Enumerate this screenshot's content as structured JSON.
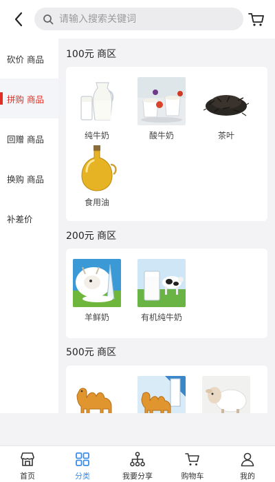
{
  "header": {
    "search_placeholder": "请输入搜索关键词"
  },
  "sidebar": {
    "items": [
      {
        "label": "砍价 商品",
        "active": false
      },
      {
        "label": "拼购 商品",
        "active": true
      },
      {
        "label": "回赠 商品",
        "active": false
      },
      {
        "label": "换购 商品",
        "active": false
      },
      {
        "label": "补差价",
        "active": false
      }
    ]
  },
  "sections": [
    {
      "title": "100元 商区",
      "products": [
        {
          "name": "纯牛奶",
          "icon": "milk-jug-icon"
        },
        {
          "name": "酸牛奶",
          "icon": "yogurt-icon"
        },
        {
          "name": "茶叶",
          "icon": "tea-leaves-icon"
        },
        {
          "name": "食用油",
          "icon": "oil-bottle-icon"
        }
      ]
    },
    {
      "title": "200元 商区",
      "products": [
        {
          "name": "羊鲜奶",
          "icon": "goat-milk-icon"
        },
        {
          "name": "有机纯牛奶",
          "icon": "cow-milk-icon"
        }
      ]
    },
    {
      "title": "500元 商区",
      "products": [
        {
          "name": "",
          "icon": "camel-icon"
        },
        {
          "name": "",
          "icon": "camel-milk-icon"
        },
        {
          "name": "",
          "icon": "sheep-icon"
        }
      ]
    }
  ],
  "tabbar": {
    "items": [
      {
        "label": "首页",
        "icon": "store-icon",
        "active": false
      },
      {
        "label": "分类",
        "icon": "grid-icon",
        "active": true
      },
      {
        "label": "我要分享",
        "icon": "share-network-icon",
        "active": false
      },
      {
        "label": "购物车",
        "icon": "cart-icon",
        "active": false
      },
      {
        "label": "我的",
        "icon": "user-icon",
        "active": false
      }
    ]
  },
  "colors": {
    "accent_red": "#e02e24",
    "accent_blue": "#3d8de8",
    "page_bg": "#f3f3f5"
  }
}
